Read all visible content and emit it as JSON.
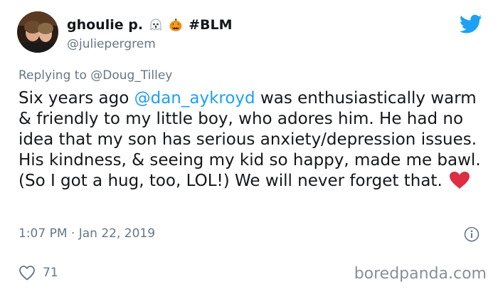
{
  "tweet": {
    "display_name": "ghoulie p.",
    "hashtag": "#BLM",
    "handle": "@juliepergrem",
    "reply_prefix": "Replying to",
    "reply_to": "@Doug_Tilley",
    "text_before_mention": "Six years ago ",
    "mention": "@dan_aykroyd",
    "text_after_mention": " was enthusiastically warm & friendly to my little boy, who adores him. He had no idea that my son has serious anxiety/depression issues. His kindness, & seeing my kid so happy, made me bawl. (So I got a hug, too, LOL!) We will never forget that.",
    "timestamp": "1:07 PM · Jan 22, 2019",
    "like_count": "71"
  },
  "watermark": "boredpanda.com",
  "icons": {
    "name_emoji_1": "ghost-emoji",
    "name_emoji_2": "pumpkin-emoji",
    "brand": "twitter-bird-icon",
    "info": "info-icon",
    "like": "heart-outline-icon",
    "text_emoji": "red-heart-emoji"
  },
  "colors": {
    "text": "#14171a",
    "secondary": "#657786",
    "link": "#1da1f2",
    "heart": "#e0245e"
  }
}
